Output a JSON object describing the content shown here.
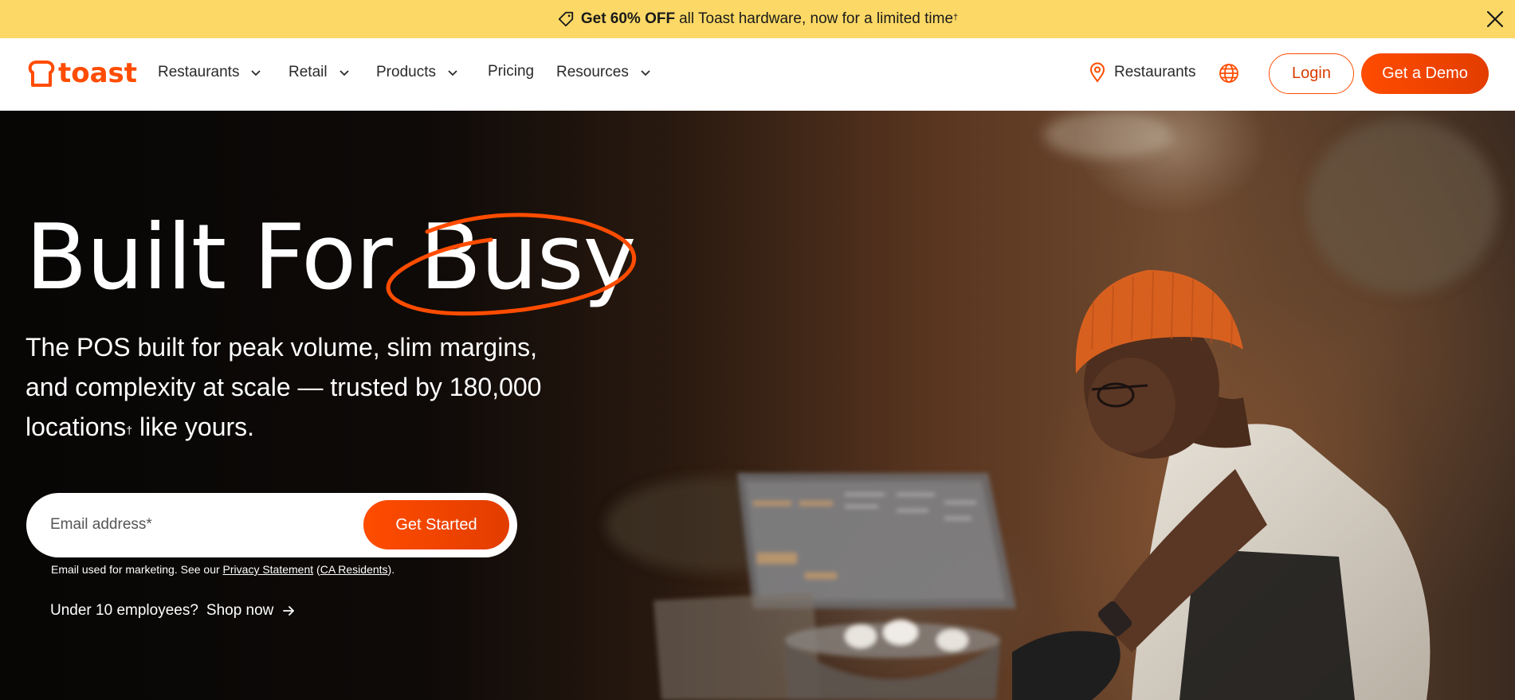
{
  "promo": {
    "bold": "Get 60% OFF",
    "text": "all Toast hardware, now for a limited time",
    "dagger": "†",
    "icons": [
      "price-tag-icon",
      "close-icon"
    ]
  },
  "nav": {
    "logo_text": "toast",
    "items": [
      {
        "label": "Restaurants",
        "has_dropdown": true
      },
      {
        "label": "Retail",
        "has_dropdown": true
      },
      {
        "label": "Products",
        "has_dropdown": true
      },
      {
        "label": "Pricing",
        "has_dropdown": false
      },
      {
        "label": "Resources",
        "has_dropdown": true
      }
    ],
    "location_label": "Restaurants",
    "login_label": "Login",
    "demo_label": "Get a Demo"
  },
  "hero": {
    "headline_a": "Built For",
    "headline_b": "Busy",
    "sub_line1": "The POS built for peak volume, slim margins,",
    "sub_line2": "and complexity at scale — trusted by 180,000",
    "sub_line3a": "locations",
    "sub_dagger": "†",
    "sub_line3b": " like yours.",
    "email_placeholder": "Email address*",
    "cta_label": "Get Started",
    "disclaimer_pre": "Email used for marketing. See our ",
    "privacy_link": "Privacy Statement",
    "disclaimer_mid": " (",
    "ca_link": "CA Residents",
    "disclaimer_post": ").",
    "small_biz_text": "Under 10 employees?",
    "shop_link": "Shop now"
  },
  "colors": {
    "accent": "#ff4c00",
    "promo_bg": "#fcd966",
    "nav_bg": "#ffffff"
  }
}
